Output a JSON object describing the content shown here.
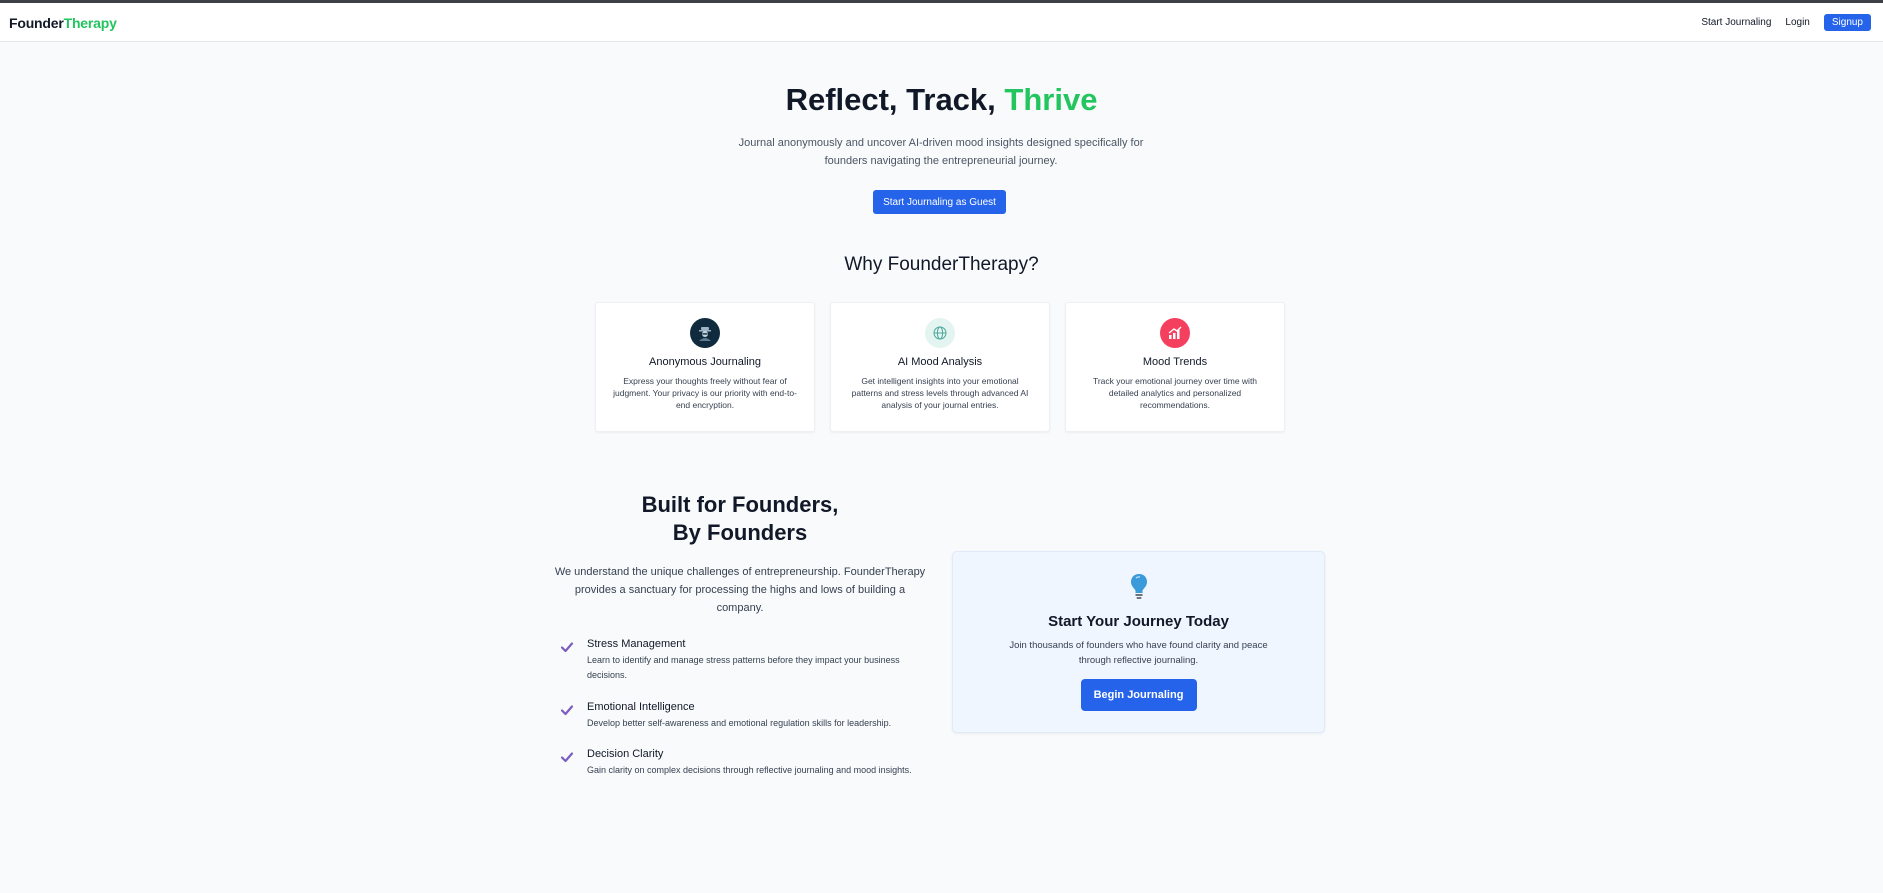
{
  "nav": {
    "logo_part1": "Founder",
    "logo_part2": "Therapy",
    "links": {
      "start_journaling": "Start Journaling",
      "login": "Login",
      "signup": "Signup"
    }
  },
  "hero": {
    "title_part1": "Reflect, Track, ",
    "title_accent": "Thrive",
    "subtitle": "Journal anonymously and uncover AI-driven mood insights designed specifically for founders navigating the entrepreneurial journey.",
    "button": "Start Journaling as Guest"
  },
  "why": {
    "title": "Why FounderTherapy?",
    "cards": [
      {
        "title": "Anonymous Journaling",
        "text": "Express your thoughts freely without fear of judgment. Your privacy is our priority with end-to-end encryption.",
        "icon": "anonymous-user-icon"
      },
      {
        "title": "AI Mood Analysis",
        "text": "Get intelligent insights into your emotional patterns and stress levels through advanced AI analysis of your journal entries.",
        "icon": "ai-globe-icon"
      },
      {
        "title": "Mood Trends",
        "text": "Track your emotional journey over time with detailed analytics and personalized recommendations.",
        "icon": "trend-chart-icon"
      }
    ]
  },
  "built": {
    "title_line1": "Built for Founders,",
    "title_line2": "By Founders",
    "subtitle": "We understand the unique challenges of entrepreneurship. FounderTherapy provides a sanctuary for processing the highs and lows of building a company.",
    "features": [
      {
        "title": "Stress Management",
        "text": "Learn to identify and manage stress patterns before they impact your business decisions."
      },
      {
        "title": "Emotional Intelligence",
        "text": "Develop better self-awareness and emotional regulation skills for leadership."
      },
      {
        "title": "Decision Clarity",
        "text": "Gain clarity on complex decisions through reflective journaling and mood insights."
      }
    ]
  },
  "cta": {
    "title": "Start Your Journey Today",
    "text": "Join thousands of founders who have found clarity and peace through reflective journaling.",
    "button": "Begin Journaling",
    "icon": "lightbulb-icon"
  },
  "colors": {
    "brand_green": "#22c55e",
    "primary_blue": "#2563eb",
    "check_purple": "#7c5cbf",
    "trend_red": "#f43f5e"
  }
}
